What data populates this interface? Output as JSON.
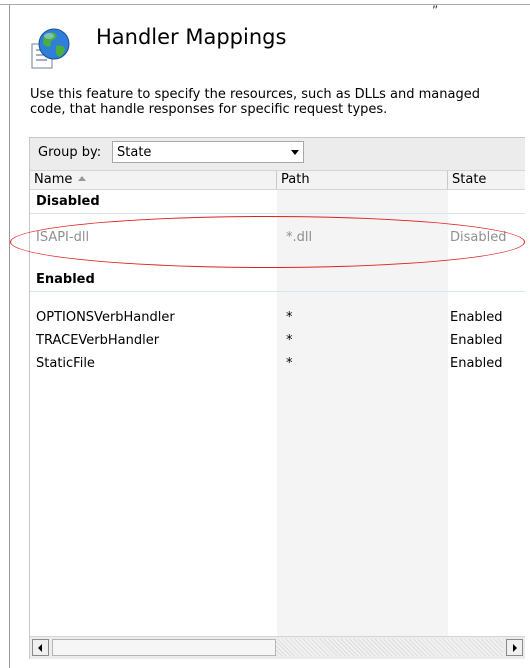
{
  "top_mark": "„",
  "header": {
    "title": "Handler Mappings",
    "icon": "globe-icon"
  },
  "description": "Use this feature to specify the resources, such as DLLs and managed code, that handle responses for specific request types.",
  "groupby": {
    "label": "Group by:",
    "value": "State"
  },
  "columns": {
    "name": "Name",
    "path": "Path",
    "state": "State"
  },
  "groups": {
    "disabled": {
      "label": "Disabled",
      "rows": [
        {
          "name": "ISAPI-dll",
          "path": "*.dll",
          "state": "Disabled"
        }
      ]
    },
    "enabled": {
      "label": "Enabled",
      "rows": [
        {
          "name": "OPTIONSVerbHandler",
          "path": "*",
          "state": "Enabled"
        },
        {
          "name": "TRACEVerbHandler",
          "path": "*",
          "state": "Enabled"
        },
        {
          "name": "StaticFile",
          "path": "*",
          "state": "Enabled"
        }
      ]
    }
  },
  "colors": {
    "annotation": "#e02020",
    "disabled_text": "#8f8f8f",
    "group_divider": "#d9e4f2"
  }
}
